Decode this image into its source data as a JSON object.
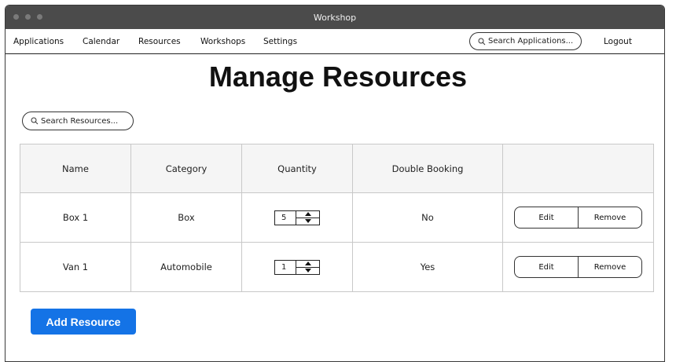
{
  "window": {
    "title": "Workshop"
  },
  "nav": {
    "items": [
      "Applications",
      "Calendar",
      "Resources",
      "Workshops",
      "Settings"
    ],
    "search_placeholder": "Search Applications...",
    "logout": "Logout"
  },
  "page": {
    "title": "Manage Resources",
    "search_placeholder": "Search Resources..."
  },
  "table": {
    "headers": [
      "Name",
      "Category",
      "Quantity",
      "Double Booking",
      ""
    ],
    "rows": [
      {
        "name": "Box 1",
        "category": "Box",
        "quantity": "5",
        "double_booking": "No",
        "edit": "Edit",
        "remove": "Remove"
      },
      {
        "name": "Van 1",
        "category": "Automobile",
        "quantity": "1",
        "double_booking": "Yes",
        "edit": "Edit",
        "remove": "Remove"
      }
    ]
  },
  "actions": {
    "add_resource": "Add Resource"
  },
  "colors": {
    "primary": "#1473e6",
    "titlebar": "#4b4b4b"
  },
  "icons": [
    "search-icon",
    "chevron-up-icon",
    "chevron-down-icon"
  ]
}
